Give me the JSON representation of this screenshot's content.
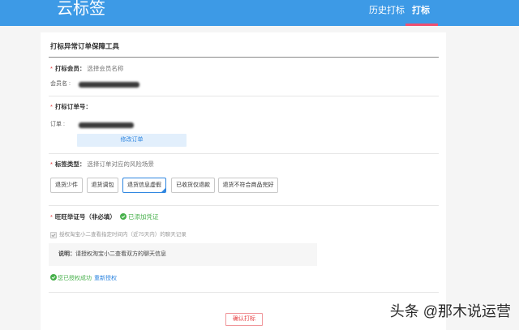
{
  "theme": {
    "header_bg": "#3d9ae6",
    "active_underline": "#ef4f70",
    "required": "#e4393c",
    "success": "#47b04b",
    "link": "#2f86e0",
    "selected_border": "#2f86e0",
    "modify_bg": "#e2effc",
    "submit": "#e4393c"
  },
  "header": {
    "app_title": "云标签",
    "nav": [
      {
        "label": "历史打标",
        "active": false
      },
      {
        "label": "打标",
        "active": true
      }
    ]
  },
  "form": {
    "title": "打标异常订单保障工具",
    "member": {
      "required_mark": "*",
      "label": "打标会员：",
      "hint": "选择会员名称",
      "field_label": "会员名 :"
    },
    "order": {
      "required_mark": "*",
      "label": "打标订单号：",
      "field_label": "订单 :",
      "modify_label": "修改订单"
    },
    "tag_type": {
      "required_mark": "*",
      "label": "标签类型：",
      "hint": "选择订单对应的风险场景",
      "options": [
        {
          "label": "退货少件",
          "selected": false
        },
        {
          "label": "退货调包",
          "selected": false
        },
        {
          "label": "退货信息虚假",
          "selected": true
        },
        {
          "label": "已收货仅退款",
          "selected": false
        },
        {
          "label": "退货不符合商品完好",
          "selected": false
        }
      ]
    },
    "evidence": {
      "required_mark": "*",
      "label": "旺旺举证号（非必填）",
      "status": "已添加凭证",
      "authorize_checked": true,
      "authorize_text": "授权淘宝小二查看指定时间内（近75天内）的聊天记录",
      "note_label": "说明：",
      "note_text": "请授权淘宝小二查看双方的聊天信息",
      "auth_success": "您已授权成功",
      "reauth_label": "重新授权"
    },
    "submit_label": "确认打标"
  },
  "watermark": {
    "text": "头条 @那木说运营"
  }
}
